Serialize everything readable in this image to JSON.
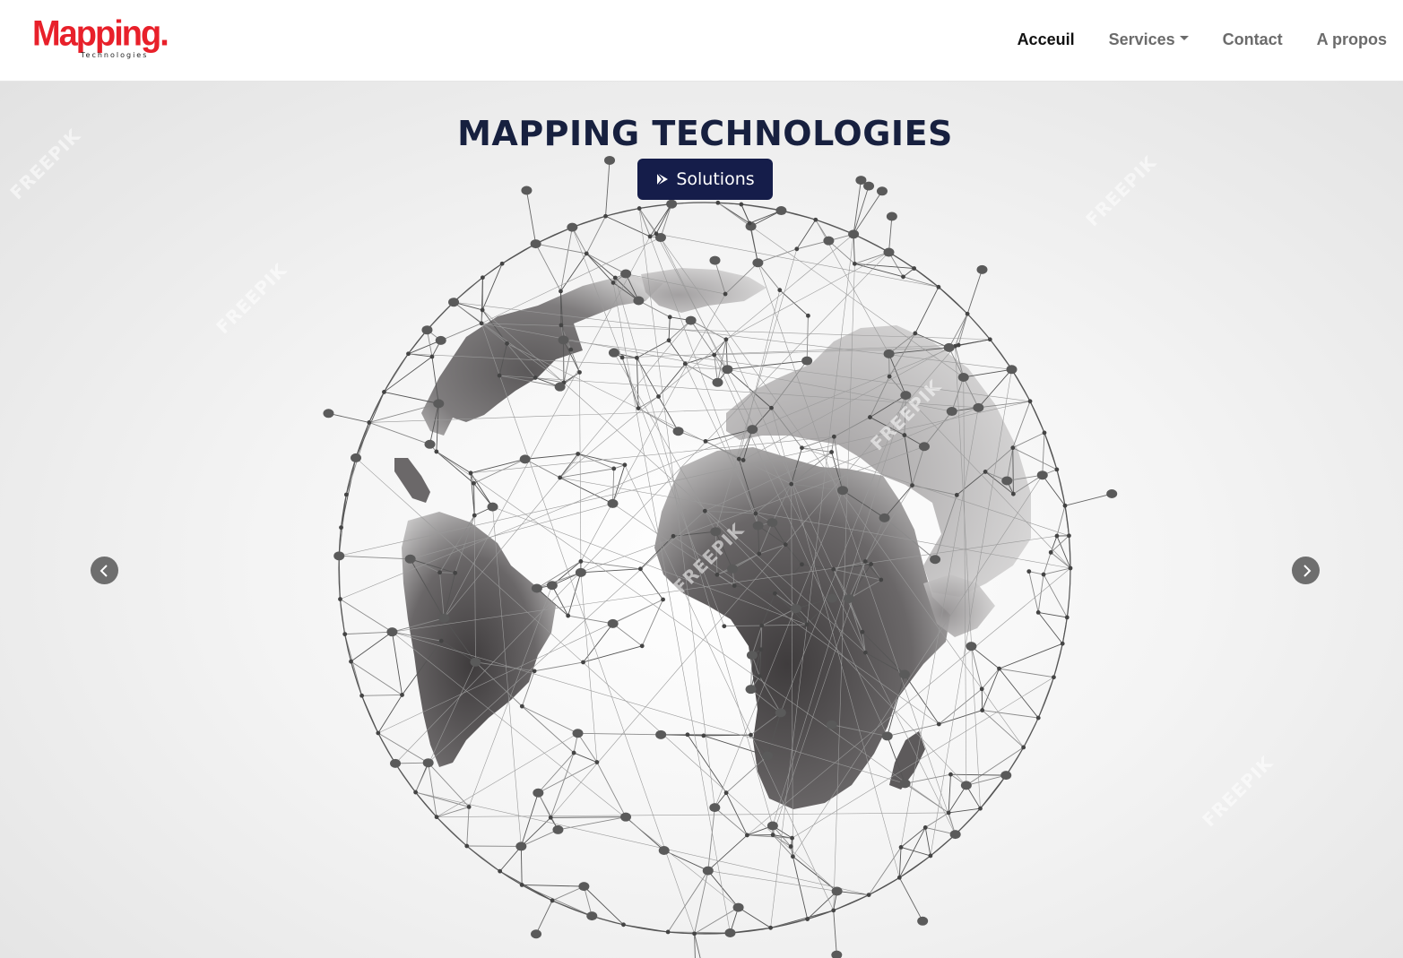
{
  "brand": {
    "logo_text": "Mapping.",
    "logo_subtext": "Technologies",
    "logo_color": "#e8202a"
  },
  "nav": {
    "items": [
      {
        "label": "Acceuil",
        "active": true
      },
      {
        "label": "Services",
        "dropdown": true
      },
      {
        "label": "Contact"
      },
      {
        "label": "A propos"
      }
    ]
  },
  "hero": {
    "title": "MAPPING TECHNOLOGIES",
    "button_label": "Solutions",
    "button_icon": "play-icon",
    "button_color": "#151d4a",
    "title_color": "#17203f",
    "watermark_text": "FREEPIK",
    "prev_icon": "chevron-left-icon",
    "next_icon": "chevron-right-icon"
  }
}
